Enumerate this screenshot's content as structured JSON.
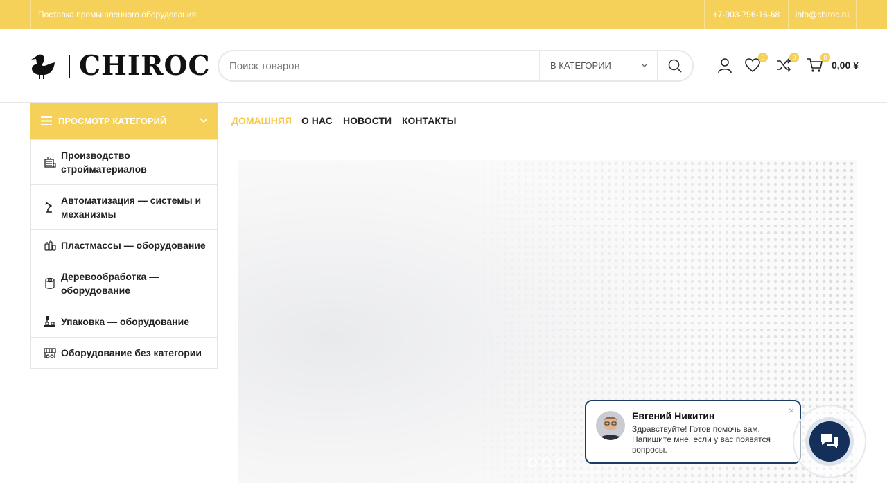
{
  "topbar": {
    "tagline": "Поставка промышленного оборудования",
    "phone": "+7-903-796-16-68",
    "email": "info@chiroc.ru"
  },
  "header": {
    "logo_text": "CHIROC",
    "search": {
      "placeholder": "Поиск товаров",
      "category_label": "В КАТЕГОРИИ"
    },
    "wishlist_count": "0",
    "compare_count": "0",
    "cart_count": "0",
    "cart_total": "0,00 ¥"
  },
  "nav": {
    "categories_button": "Просмотр категорий",
    "links": [
      "ДОМАШНЯЯ",
      "О НАС",
      "НОВОСТИ",
      "КОНТАКТЫ"
    ],
    "active_index": 0
  },
  "categories": [
    {
      "label": "Производство стройматериалов",
      "icon": "building-materials-icon"
    },
    {
      "label": "Автоматизация — системы и механизмы",
      "icon": "robot-arm-icon"
    },
    {
      "label": "Пластмассы — оборудование",
      "icon": "plastic-bottles-icon"
    },
    {
      "label": "Деревообработка — оборудование",
      "icon": "wood-log-icon"
    },
    {
      "label": "Упаковка — оборудование",
      "icon": "packaging-machine-icon"
    },
    {
      "label": "Оборудование без категории",
      "icon": "conveyor-icon"
    }
  ],
  "slider": {
    "dots": 3,
    "active_dot": 0
  },
  "chat": {
    "agent_name": "Евгений Никитин",
    "message": "Здравствуйте! Готов помочь вам. Напишите мне, если у вас появятся вопросы.",
    "close_label": "×"
  },
  "colors": {
    "accent": "#f5d15a",
    "chat_border": "#1c3a63",
    "chat_button": "#14305a"
  }
}
